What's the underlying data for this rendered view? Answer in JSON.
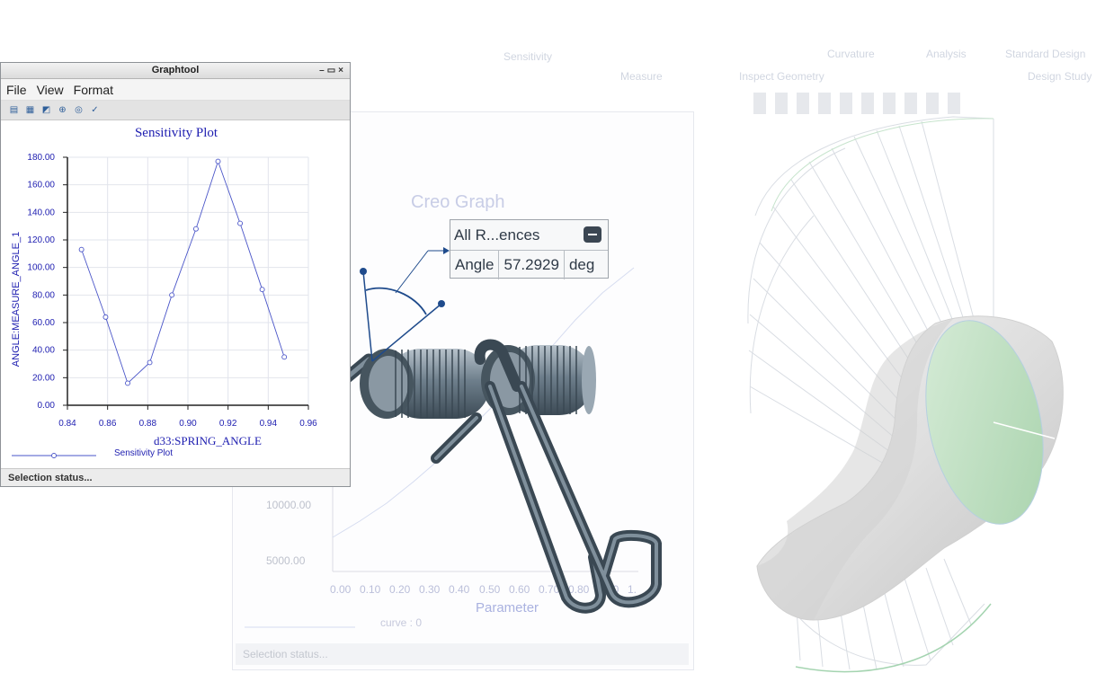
{
  "background": {
    "ribbon_items": [
      "Sensitivity",
      "Measure",
      "Inspect Geometry",
      "Design Study",
      "Curvature",
      "Analysis",
      "Standard Design"
    ],
    "graph_title": "Creo Graph",
    "x_axis_label": "Parameter",
    "x_ticks": [
      "0.00",
      "0.10",
      "0.20",
      "0.30",
      "0.40",
      "0.50",
      "0.60",
      "0.70",
      "0.80",
      "0.90",
      "1."
    ],
    "y_ticks": [
      "10000.00",
      "5000.00"
    ],
    "legend_label": "curve : 0",
    "status": "Selection status..."
  },
  "graphtool": {
    "title": "Graphtool",
    "menu": [
      "File",
      "View",
      "Format"
    ],
    "status": "Selection status..."
  },
  "chart_data": {
    "type": "line",
    "title": "Sensitivity Plot",
    "xlabel": "d33:SPRING_ANGLE",
    "ylabel": "ANGLE:MEASURE_ANGLE_1",
    "xlim": [
      0.84,
      0.96
    ],
    "ylim": [
      0,
      180
    ],
    "x_ticks": [
      "0.84",
      "0.86",
      "0.88",
      "0.90",
      "0.92",
      "0.94",
      "0.96"
    ],
    "y_ticks": [
      "0.00",
      "20.00",
      "40.00",
      "60.00",
      "80.00",
      "100.00",
      "120.00",
      "140.00",
      "160.00",
      "180.00"
    ],
    "grid": true,
    "legend": "bottom-left",
    "series": [
      {
        "name": "Sensitivity Plot",
        "color": "#4a55c8",
        "x": [
          0.847,
          0.859,
          0.87,
          0.881,
          0.892,
          0.904,
          0.915,
          0.926,
          0.937,
          0.948
        ],
        "y": [
          113,
          64,
          16,
          31,
          80,
          128,
          177,
          132,
          84,
          35
        ]
      }
    ]
  },
  "callout": {
    "title": "All R...ences",
    "label": "Angle",
    "value": "57.2929",
    "unit": "deg"
  }
}
